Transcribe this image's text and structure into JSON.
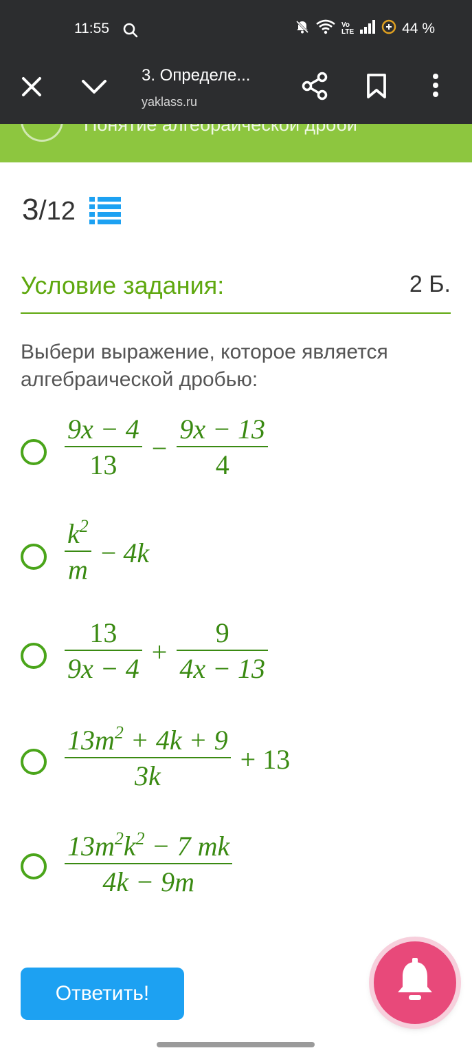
{
  "status_bar": {
    "time": "11:55",
    "battery": "44 %",
    "network_label_top": "Vo",
    "network_label_bottom": "LTE",
    "icons": [
      "search-icon",
      "mute-icon",
      "wifi-icon",
      "signal-icon",
      "battery-saver-icon"
    ]
  },
  "toolbar": {
    "title": "3. Определе...",
    "url": "yaklass.ru",
    "icons": [
      "close-icon",
      "chevron-down-icon",
      "share-icon",
      "bookmark-icon",
      "more-vert-icon"
    ]
  },
  "topic_bar": {
    "title": "Понятие алгебраической дроби",
    "color": "#8dc63f"
  },
  "counter": {
    "current": "3",
    "separator": "/",
    "total": "12",
    "icon": "list-icon"
  },
  "condition": {
    "label": "Условие задания:",
    "points": "2 Б."
  },
  "question": "Выбери выражение, которое является алгебраической дробью:",
  "options": [
    {
      "num1": "9x − 4",
      "den1": "13",
      "op": "−",
      "num2": "9x − 13",
      "den2": "4"
    },
    {
      "num1_base": "k",
      "num1_exp": "2",
      "den1": "m",
      "rest_op": "−",
      "rest": "4k"
    },
    {
      "num1": "13",
      "den1": "9x − 4",
      "op": "+",
      "num2": "9",
      "den2": "4x − 13"
    },
    {
      "num_a": "13m",
      "num_a_exp": "2",
      "num_b": " + 4k + 9",
      "den1": "3k",
      "rest_op": "+",
      "rest": "13"
    },
    {
      "num_a": "13m",
      "num_a_exp": "2",
      "num_b": "k",
      "num_b_exp": "2",
      "num_c": " − 7 mk",
      "den1": "4k − 9m"
    }
  ],
  "answer_button": "Ответить!",
  "colors": {
    "accent_green": "#5fa80f",
    "math_green": "#3a8a12",
    "button_blue": "#1da1f2",
    "bell_pink": "#e8497a",
    "dark_bar": "#2c2d2f"
  },
  "fab_icon": "bell-icon"
}
